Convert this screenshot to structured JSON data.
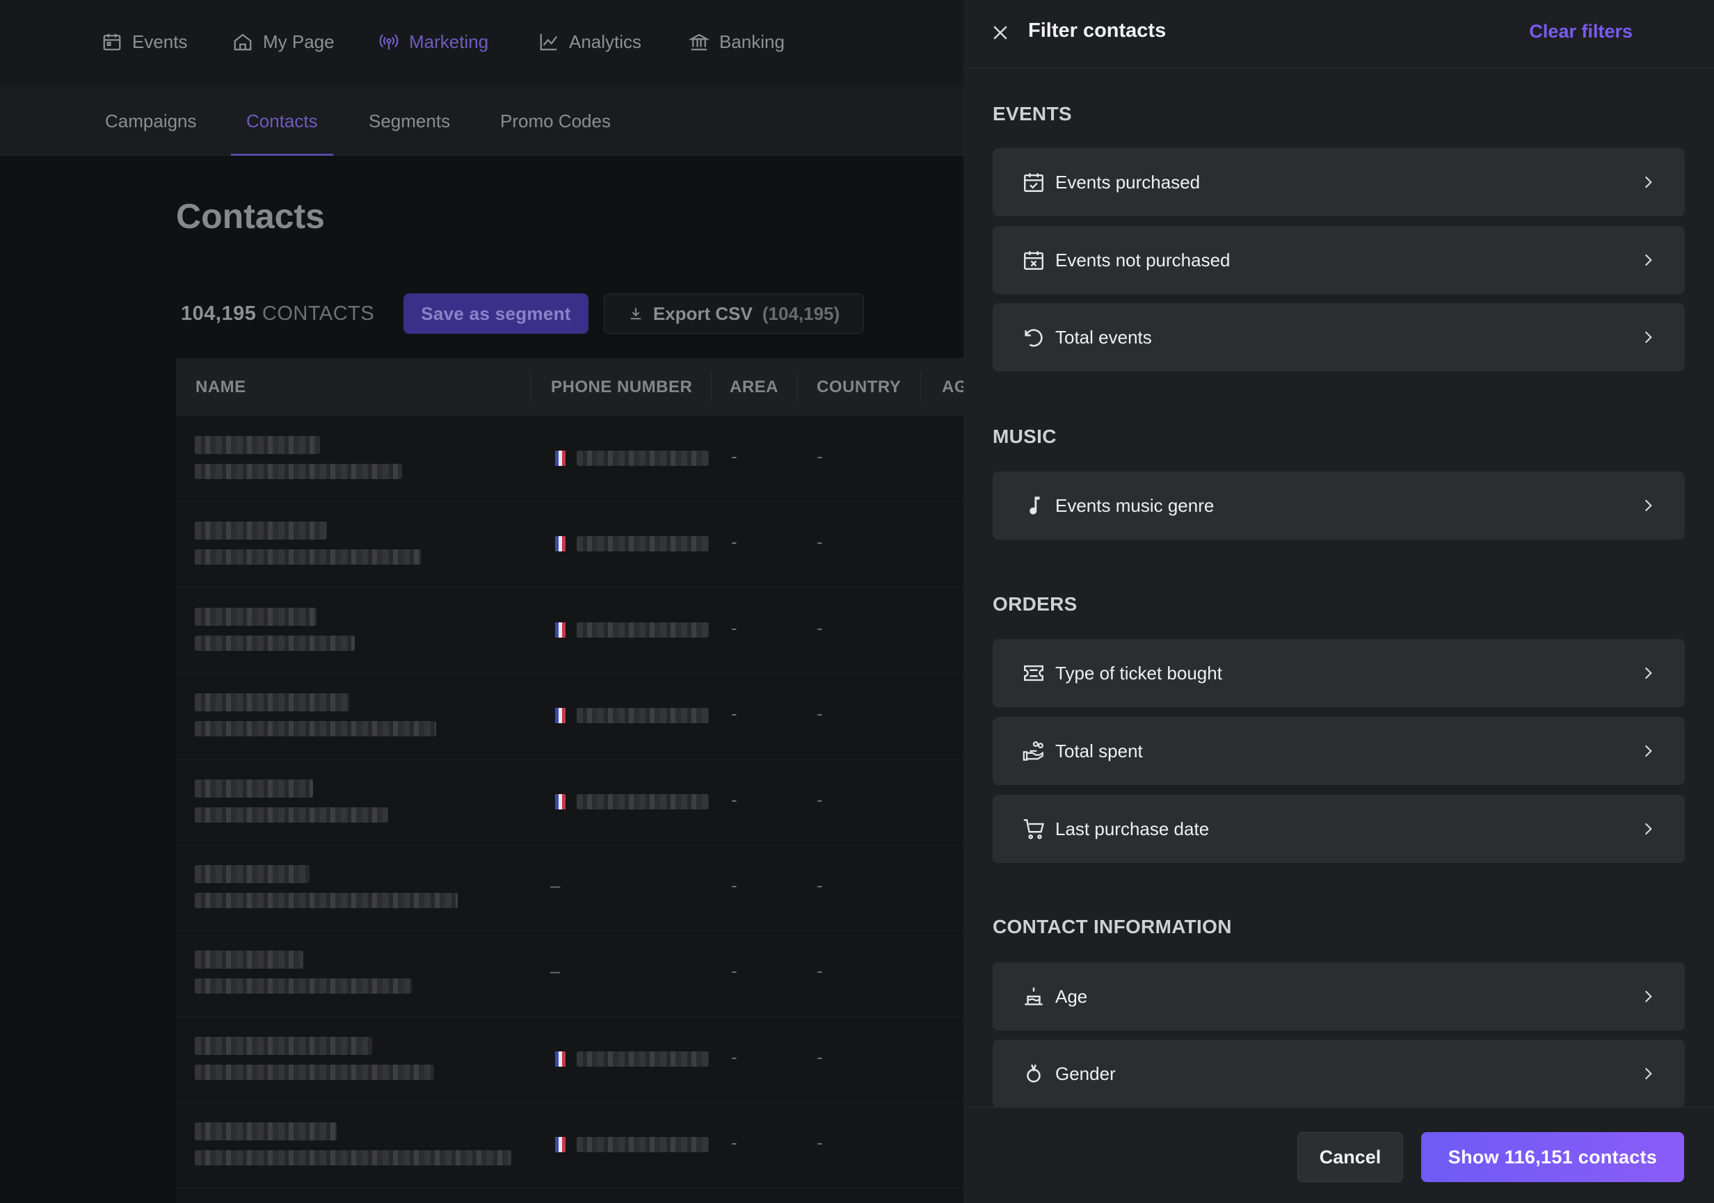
{
  "topnav": {
    "items": [
      {
        "label": "Events",
        "icon": "calendar-icon"
      },
      {
        "label": "My Page",
        "icon": "home-icon"
      },
      {
        "label": "Marketing",
        "icon": "broadcast-icon",
        "active": true
      },
      {
        "label": "Analytics",
        "icon": "chart-line-icon"
      },
      {
        "label": "Banking",
        "icon": "bank-icon"
      }
    ]
  },
  "subnav": {
    "tabs": [
      {
        "label": "Campaigns"
      },
      {
        "label": "Contacts",
        "active": true
      },
      {
        "label": "Segments"
      },
      {
        "label": "Promo Codes"
      }
    ]
  },
  "page": {
    "title": "Contacts",
    "count_number": "104,195",
    "count_unit": "CONTACTS",
    "save_segment_label": "Save as segment",
    "export_label": "Export CSV",
    "export_count": "(104,195)"
  },
  "table": {
    "columns": [
      "NAME",
      "PHONE NUMBER",
      "AREA",
      "COUNTRY",
      "AG"
    ],
    "rows": [
      {
        "phone_flag": true,
        "area": "-",
        "country": "-"
      },
      {
        "phone_flag": true,
        "area": "-",
        "country": "-"
      },
      {
        "phone_flag": true,
        "area": "-",
        "country": "-"
      },
      {
        "phone_flag": true,
        "area": "-",
        "country": "-"
      },
      {
        "phone_flag": true,
        "area": "-",
        "country": "-"
      },
      {
        "phone_flag": false,
        "phone": "–",
        "area": "-",
        "country": "-"
      },
      {
        "phone_flag": false,
        "phone": "–",
        "area": "-",
        "country": "-"
      },
      {
        "phone_flag": true,
        "area": "-",
        "country": "-"
      },
      {
        "phone_flag": true,
        "area": "-",
        "country": "-"
      }
    ]
  },
  "filter_panel": {
    "title": "Filter contacts",
    "clear_label": "Clear filters",
    "sections": [
      {
        "label": "EVENTS",
        "options": [
          {
            "label": "Events purchased",
            "icon": "calendar-check-icon"
          },
          {
            "label": "Events not purchased",
            "icon": "calendar-x-icon"
          },
          {
            "label": "Total events",
            "icon": "rotate-ccw-icon"
          }
        ]
      },
      {
        "label": "MUSIC",
        "options": [
          {
            "label": "Events music genre",
            "icon": "music-note-icon"
          }
        ]
      },
      {
        "label": "ORDERS",
        "options": [
          {
            "label": "Type of ticket bought",
            "icon": "ticket-icon"
          },
          {
            "label": "Total spent",
            "icon": "hand-coins-icon"
          },
          {
            "label": "Last purchase date",
            "icon": "shopping-cart-icon"
          }
        ]
      },
      {
        "label": "CONTACT INFORMATION",
        "options": [
          {
            "label": "Age",
            "icon": "cake-icon"
          },
          {
            "label": "Gender",
            "icon": "gender-icon"
          }
        ]
      }
    ],
    "cancel_label": "Cancel",
    "show_label": "Show 116,151 contacts"
  },
  "colors": {
    "accent": "#7a5cf0",
    "panel_bg": "#1e1f22",
    "option_bg": "#2c2d31",
    "flag_blue": "#3b4aa8",
    "flag_red": "#c0394a"
  }
}
